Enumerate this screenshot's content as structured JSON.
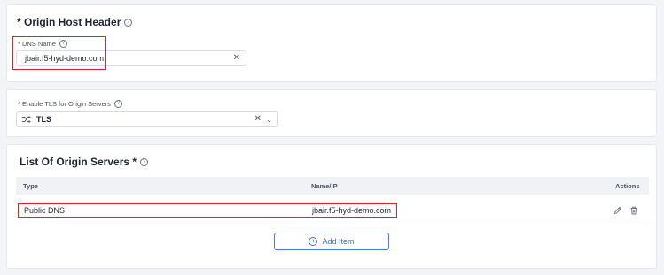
{
  "origin_host_header": {
    "title": "* Origin Host Header",
    "dns_label": "* DNS Name",
    "dns_value": "jbair.f5-hyd-demo.com"
  },
  "tls": {
    "label": "* Enable TLS for Origin Servers",
    "value": "TLS"
  },
  "origin_servers": {
    "title": "List Of Origin Servers *",
    "columns": {
      "type": "Type",
      "name_ip": "Name/IP",
      "actions": "Actions"
    },
    "rows": [
      {
        "type": "Public DNS",
        "name_ip": "jbair.f5-hyd-demo.com"
      }
    ],
    "add_label": "Add Item"
  },
  "icons": {
    "help": "question-circle-icon",
    "clear": "close-icon",
    "chevron": "chevron-down-icon",
    "tls": "shuffle-icon",
    "edit": "pencil-icon",
    "delete": "trash-icon",
    "add": "plus-circle-icon"
  },
  "colors": {
    "highlight": "#e0222d",
    "accent": "#3d6ad6"
  }
}
